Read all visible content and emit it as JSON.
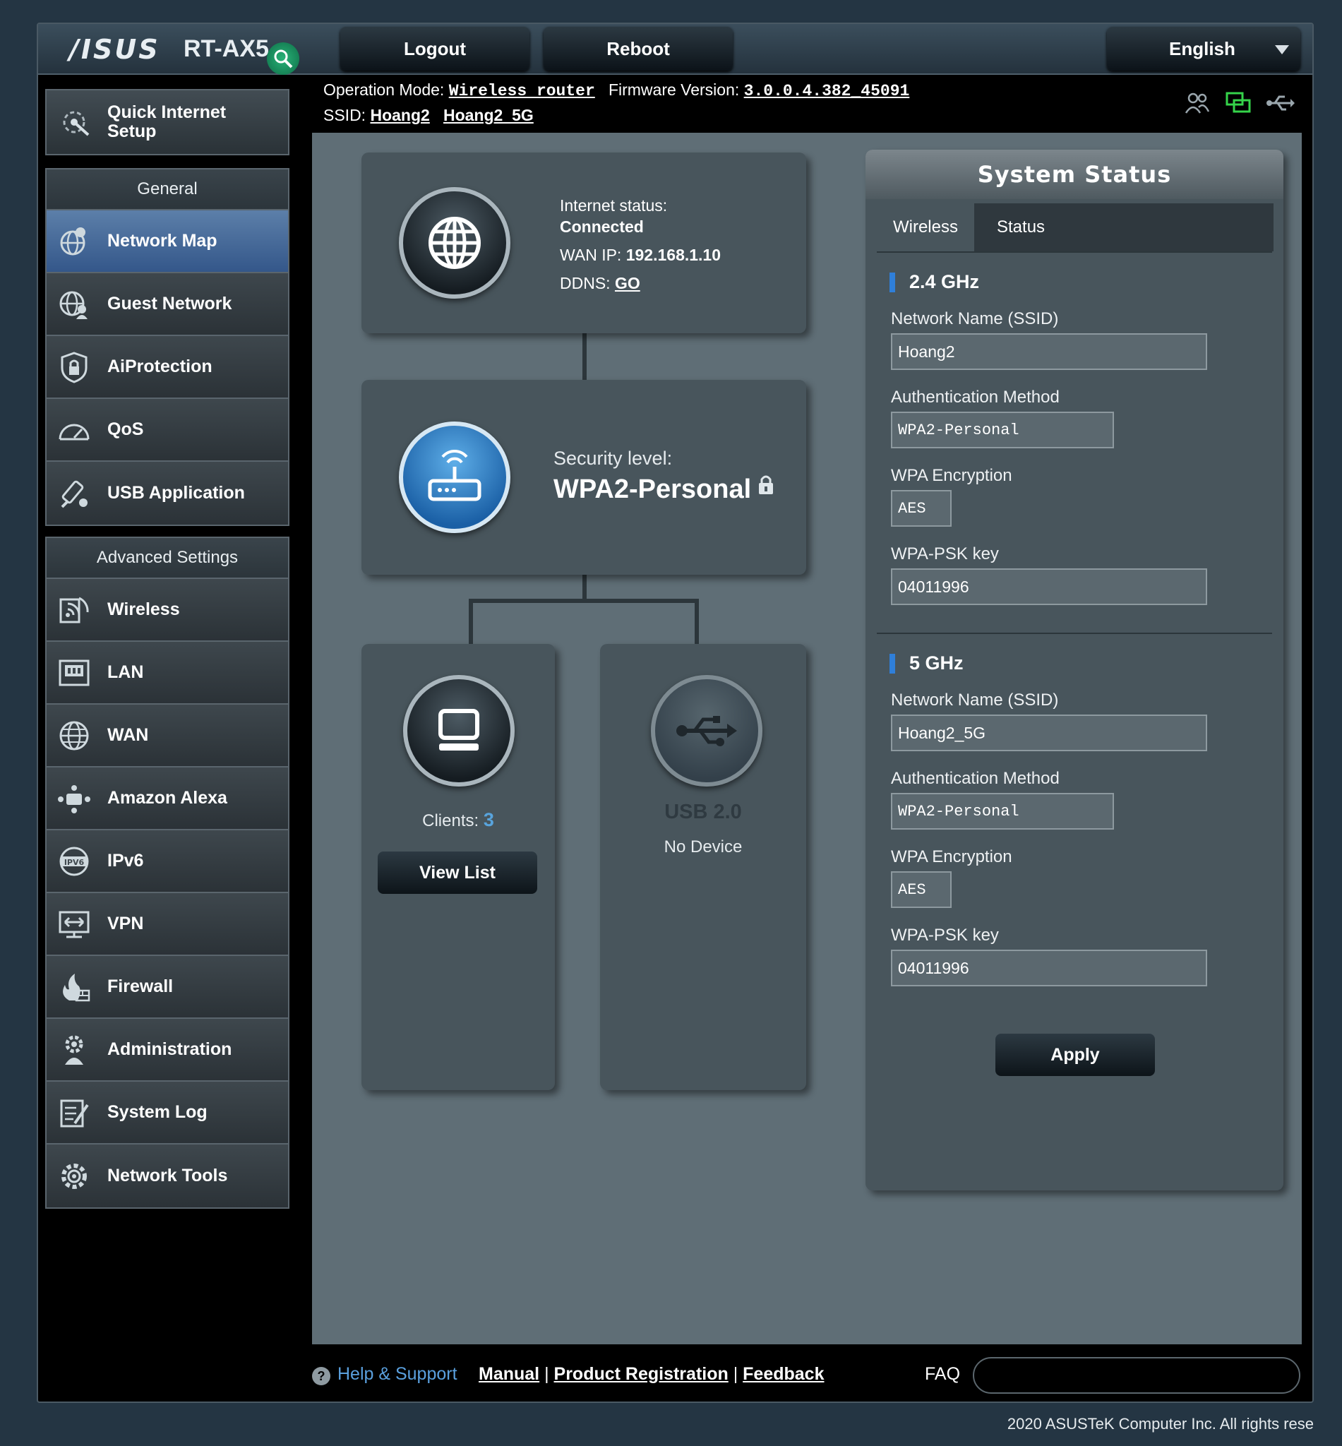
{
  "header": {
    "brand": "/ISUS",
    "model": "RT-AX5",
    "logout_label": "Logout",
    "reboot_label": "Reboot",
    "language": "English"
  },
  "info": {
    "operation_mode_label": "Operation Mode:",
    "operation_mode_value": "Wireless router",
    "firmware_label": "Firmware Version:",
    "firmware_value": "3.0.0.4.382_45091",
    "ssid_label": "SSID:",
    "ssid_1": "Hoang2",
    "ssid_2": "Hoang2_5G"
  },
  "sidebar": {
    "quick_setup_line1": "Quick Internet",
    "quick_setup_line2": "Setup",
    "general_title": "General",
    "general_items": [
      {
        "label": "Network Map",
        "icon": "network-map-icon"
      },
      {
        "label": "Guest Network",
        "icon": "guest-network-icon"
      },
      {
        "label": "AiProtection",
        "icon": "shield-icon"
      },
      {
        "label": "QoS",
        "icon": "gauge-icon"
      },
      {
        "label": "USB Application",
        "icon": "usb-app-icon"
      }
    ],
    "advanced_title": "Advanced Settings",
    "advanced_items": [
      {
        "label": "Wireless",
        "icon": "wireless-icon"
      },
      {
        "label": "LAN",
        "icon": "lan-icon"
      },
      {
        "label": "WAN",
        "icon": "globe-icon"
      },
      {
        "label": "Amazon Alexa",
        "icon": "alexa-icon"
      },
      {
        "label": "IPv6",
        "icon": "ipv6-icon"
      },
      {
        "label": "VPN",
        "icon": "vpn-icon"
      },
      {
        "label": "Firewall",
        "icon": "firewall-icon"
      },
      {
        "label": "Administration",
        "icon": "admin-icon"
      },
      {
        "label": "System Log",
        "icon": "system-log-icon"
      },
      {
        "label": "Network Tools",
        "icon": "network-tools-icon"
      }
    ]
  },
  "network_map": {
    "internet_status_label": "Internet status:",
    "internet_status_value": "Connected",
    "wan_ip_label": "WAN IP:",
    "wan_ip_value": "192.168.1.10",
    "ddns_label": "DDNS:",
    "ddns_value": "GO",
    "security_label": "Security level:",
    "security_value": "WPA2-Personal",
    "clients_label": "Clients:",
    "clients_count": "3",
    "view_list_label": "View List",
    "usb_label": "USB 2.0",
    "usb_status": "No Device"
  },
  "system_status": {
    "title": "System Status",
    "tab_wireless": "Wireless",
    "tab_status": "Status",
    "bands": [
      {
        "title": "2.4 GHz",
        "ssid_label": "Network Name (SSID)",
        "ssid_value": "Hoang2",
        "auth_label": "Authentication Method",
        "auth_value": "WPA2-Personal",
        "enc_label": "WPA Encryption",
        "enc_value": "AES",
        "psk_label": "WPA-PSK key",
        "psk_value": "04011996"
      },
      {
        "title": "5 GHz",
        "ssid_label": "Network Name (SSID)",
        "ssid_value": "Hoang2_5G",
        "auth_label": "Authentication Method",
        "auth_value": "WPA2-Personal",
        "enc_label": "WPA Encryption",
        "enc_value": "AES",
        "psk_label": "WPA-PSK key",
        "psk_value": "04011996"
      }
    ],
    "apply_label": "Apply"
  },
  "footer": {
    "help_label": "Help & Support",
    "manual": "Manual",
    "registration": "Product Registration",
    "feedback": "Feedback",
    "faq_label": "FAQ",
    "faq_placeholder": "",
    "copyright": "2020 ASUSTeK Computer Inc. All rights rese"
  },
  "colors": {
    "accent_blue": "#2f7fd9",
    "active_menu": "#34578a",
    "link_blue": "#5aa0de"
  }
}
